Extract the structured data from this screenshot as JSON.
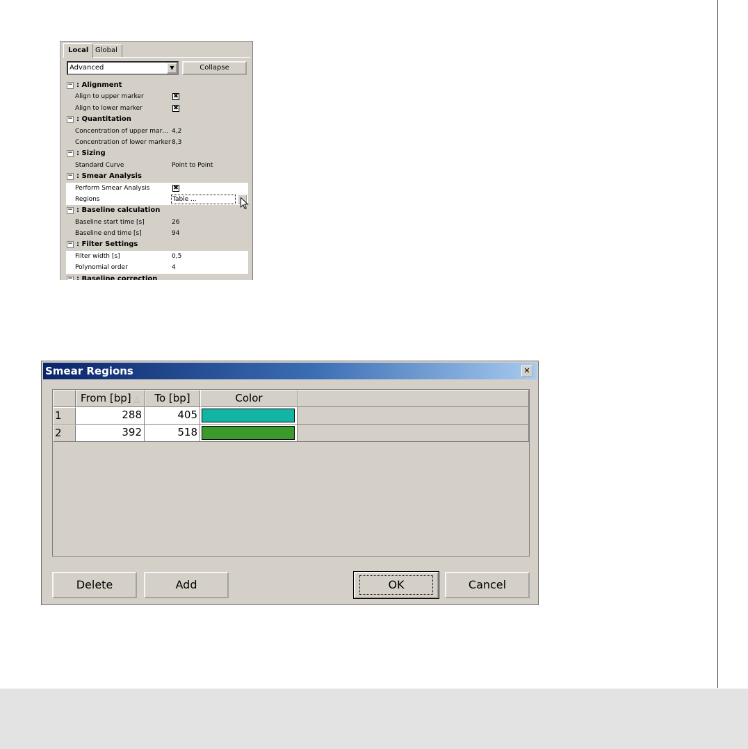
{
  "panel": {
    "tabs": [
      {
        "label": "Local",
        "active": true
      },
      {
        "label": "Global",
        "active": false
      }
    ],
    "mode_select": {
      "value": "Advanced",
      "arrow_icon": "chevron-down-icon"
    },
    "collapse_label": "Collapse",
    "toggle_symbol": "−",
    "checkbox_mark": "✖",
    "sections": {
      "alignment": {
        "title": ": Alignment",
        "items": [
          {
            "label": "Align to upper marker",
            "checked": true
          },
          {
            "label": "Align to lower marker",
            "checked": true
          }
        ]
      },
      "quantitation": {
        "title": ": Quantitation",
        "items": [
          {
            "label": "Concentration of upper marker",
            "value": "4,2"
          },
          {
            "label": "Concentration of lower marker",
            "value": "8,3"
          }
        ]
      },
      "sizing": {
        "title": ": Sizing",
        "items": [
          {
            "label": "Standard Curve",
            "value": "Point to Point"
          }
        ]
      },
      "smear": {
        "title": ": Smear Analysis",
        "items": [
          {
            "label": "Perform Smear Analysis",
            "checked": true
          },
          {
            "label": "Regions",
            "value": "Table ..."
          }
        ]
      },
      "baseline": {
        "title": ": Baseline calculation",
        "items": [
          {
            "label": "Baseline start time [s]",
            "value": "26"
          },
          {
            "label": "Baseline end time [s]",
            "value": "94"
          }
        ]
      },
      "filter": {
        "title": ": Filter Settings",
        "items": [
          {
            "label": "Filter width [s]",
            "value": "0,5"
          },
          {
            "label": "Polynomial order",
            "value": "4"
          }
        ]
      },
      "correction": {
        "title": ": Baseline correction"
      }
    }
  },
  "dialog": {
    "title": "Smear Regions",
    "close_symbol": "✕",
    "columns": [
      "From [bp]",
      "To [bp]",
      "Color"
    ],
    "sort_indicator": "△",
    "rows": [
      {
        "index": "1",
        "from": "288",
        "to": "405",
        "color": "#14b4a4"
      },
      {
        "index": "2",
        "from": "392",
        "to": "518",
        "color": "#3c9a2c"
      }
    ],
    "buttons": {
      "delete": "Delete",
      "add": "Add",
      "ok": "OK",
      "cancel": "Cancel"
    }
  }
}
